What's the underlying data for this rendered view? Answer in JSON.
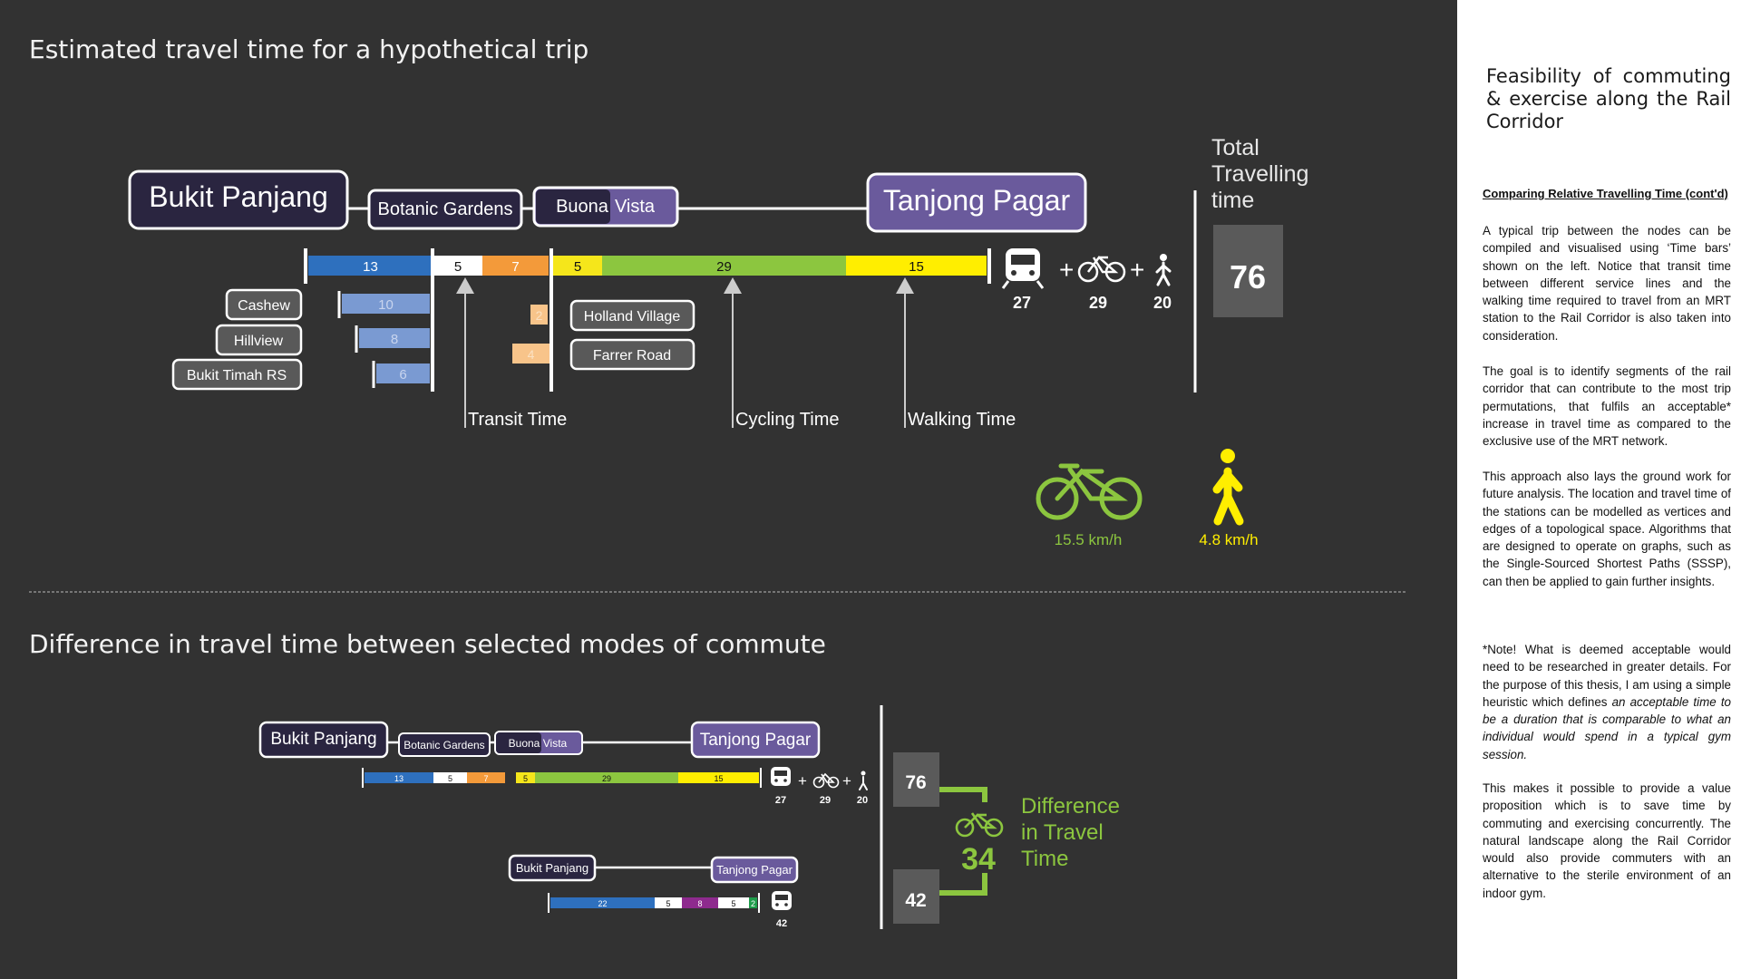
{
  "section1": {
    "title": "Estimated travel time for a hypothetical trip",
    "stations": [
      "Bukit Panjang",
      "Botanic Gardens",
      "Buona",
      "Vista",
      "Tanjong Pagar"
    ],
    "branch_labels": [
      "Cashew",
      "Hillview",
      "Bukit Timah RS",
      "Holland Village",
      "Farrer Road"
    ],
    "main_bar": [
      {
        "value": 13,
        "label": "13",
        "mode": "MRT Downtown Line",
        "color": "#2e70be"
      },
      {
        "value": 5,
        "label": "5",
        "mode": "Transit",
        "color": "#ffffff"
      },
      {
        "value": 7,
        "label": "7",
        "mode": "MRT Circle Line",
        "color": "#f39a3a"
      },
      {
        "value": 5,
        "label": "5",
        "mode": "Walking",
        "color": "#f5e61b"
      },
      {
        "value": 29,
        "label": "29",
        "mode": "Cycling",
        "color": "#8cc63f"
      },
      {
        "value": 15,
        "label": "15",
        "mode": "Walking",
        "color": "#ffee00"
      }
    ],
    "branch_bars_left": [
      "10",
      "8",
      "6"
    ],
    "branch_bars_right": [
      "2",
      "4"
    ],
    "annotations": [
      "Transit Time",
      "Cycling Time",
      "Walking Time"
    ],
    "mode_totals": {
      "train": "27",
      "bike": "29",
      "walk": "20"
    },
    "total": {
      "label_line1": "Total",
      "label_line2": "Travelling",
      "label_line3": "time",
      "value": "76"
    },
    "speeds": {
      "bike": "15.5 km/h",
      "walk": "4.8 km/h"
    }
  },
  "section2": {
    "title": "Difference in travel time between selected modes of commute",
    "route_a": {
      "stations": [
        "Bukit Panjang",
        "Botanic Gardens",
        "Buona",
        "Vista",
        "Tanjong Pagar"
      ],
      "bar": [
        "13",
        "5",
        "7",
        "5",
        "29",
        "15"
      ],
      "mode_totals": {
        "train": "27",
        "bike": "29",
        "walk": "20"
      },
      "total": "76"
    },
    "route_b": {
      "stations": [
        "Bukit Panjang",
        "Tanjong Pagar"
      ],
      "bar": [
        "22",
        "5",
        "8",
        "5",
        "2"
      ],
      "mode_totals": {
        "train": "42"
      },
      "total": "42"
    },
    "difference": {
      "value": "34",
      "line1": "Difference",
      "line2": "in Travel",
      "line3": "Time"
    }
  },
  "panel": {
    "title": "Feasibility of commuting & exercise along the Rail Corridor",
    "subtitle": "Comparing Relative Travelling Time (cont'd)",
    "para1": "A typical trip between the nodes can be compiled and visualised using ‘Time bars’ shown on the left. Notice that transit time between different service lines and the walking time required to travel from an MRT station to the Rail Corridor is also taken into consideration.",
    "para2": "The goal is to identify segments of the rail corridor that can contribute to the most trip permutations, that fulfils an acceptable* increase in travel time as compared to the exclusive use of the MRT network.",
    "para3": "This approach also lays the ground work for future analysis. The location and travel time of the stations can be modelled as vertices and edges of a topological space. Algorithms that are designed to operate on graphs, such as the Single-Sourced Shortest Paths (SSSP), can then be applied to gain further insights.",
    "note_plain": "*Note! What is deemed acceptable would need to be researched in greater details. For the purpose of this thesis, I am using a simple heuristic which defines",
    "note_italic": "an acceptable time to be a duration that is comparable to what an individual would spend in a typical gym session.",
    "para5": "This makes it possible to provide a value proposition which is to save time by commuting and exercising concurrently. The natural landscape along the Rail Corridor would also provide commuters with an alternative to the sterile environment of an indoor gym."
  },
  "colors": {
    "background": "#323232",
    "dtl_blue": "#2e70be",
    "ccl_orange": "#f39a3a",
    "cycle_green": "#8cc63f",
    "walk_yellow": "#ffee00",
    "ewl_green": "#1e9c4a",
    "nel_purple": "#8e2a8e",
    "station_purple": "#6a5a9c"
  }
}
